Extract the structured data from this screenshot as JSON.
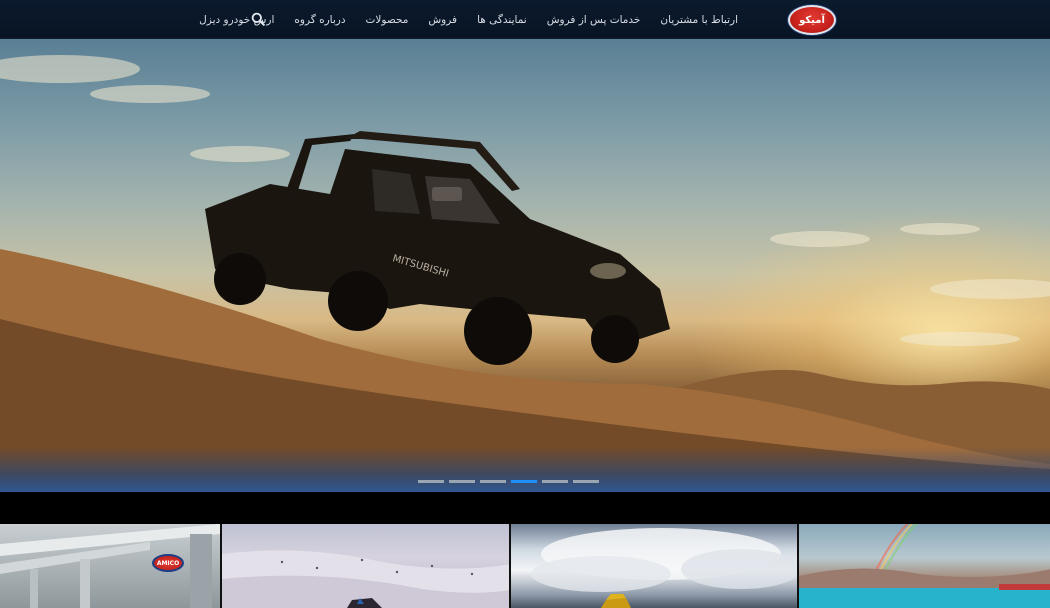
{
  "header": {
    "logo_text": "آمیکو",
    "nav": [
      "ارس خودرو دیزل",
      "درباره گروه",
      "محصولات",
      "فروش",
      "نمایندگی ها",
      "خدمات پس از فروش",
      "ارتباط با مشتریان"
    ],
    "search_icon": "search-icon"
  },
  "hero": {
    "slide_count": 6,
    "active_slide_index": 3,
    "accent_color": "#1e8fff",
    "truck_badge_text": "MITSUBISHI"
  },
  "thumbnails": {
    "first_badge_text": "AMICO"
  }
}
